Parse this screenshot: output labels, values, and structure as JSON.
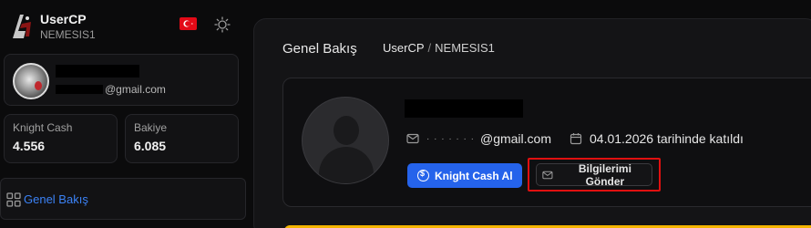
{
  "brand": {
    "title": "UserCP",
    "subtitle": "NEMESIS1",
    "logo_icon": "game-logo-icon",
    "flag_icon": "turkey-flag-icon",
    "theme_icon": "sun-icon"
  },
  "sidebar": {
    "profile": {
      "email_suffix": "@gmail.com"
    },
    "stats": [
      {
        "label": "Knight Cash",
        "value": "4.556"
      },
      {
        "label": "Bakiye",
        "value": "6.085"
      }
    ],
    "nav": [
      {
        "label": "Genel Bakış",
        "icon": "grid-icon",
        "active": true
      }
    ]
  },
  "main": {
    "title": "Genel Bakış",
    "breadcrumb": {
      "root": "UserCP",
      "separator": "/",
      "current": "NEMESIS1"
    },
    "profile": {
      "email_dots": "· · · · · · ·",
      "email_suffix": "@gmail.com",
      "joined": "04.01.2026 tarihinde katıldı",
      "buy_button": "Knight Cash Al",
      "send_button": "Bilgilerimi Gönder"
    }
  },
  "colors": {
    "accent": "#2563eb",
    "highlight": "#e01010",
    "warning": "#f4b400",
    "flag": "#e30a17"
  }
}
